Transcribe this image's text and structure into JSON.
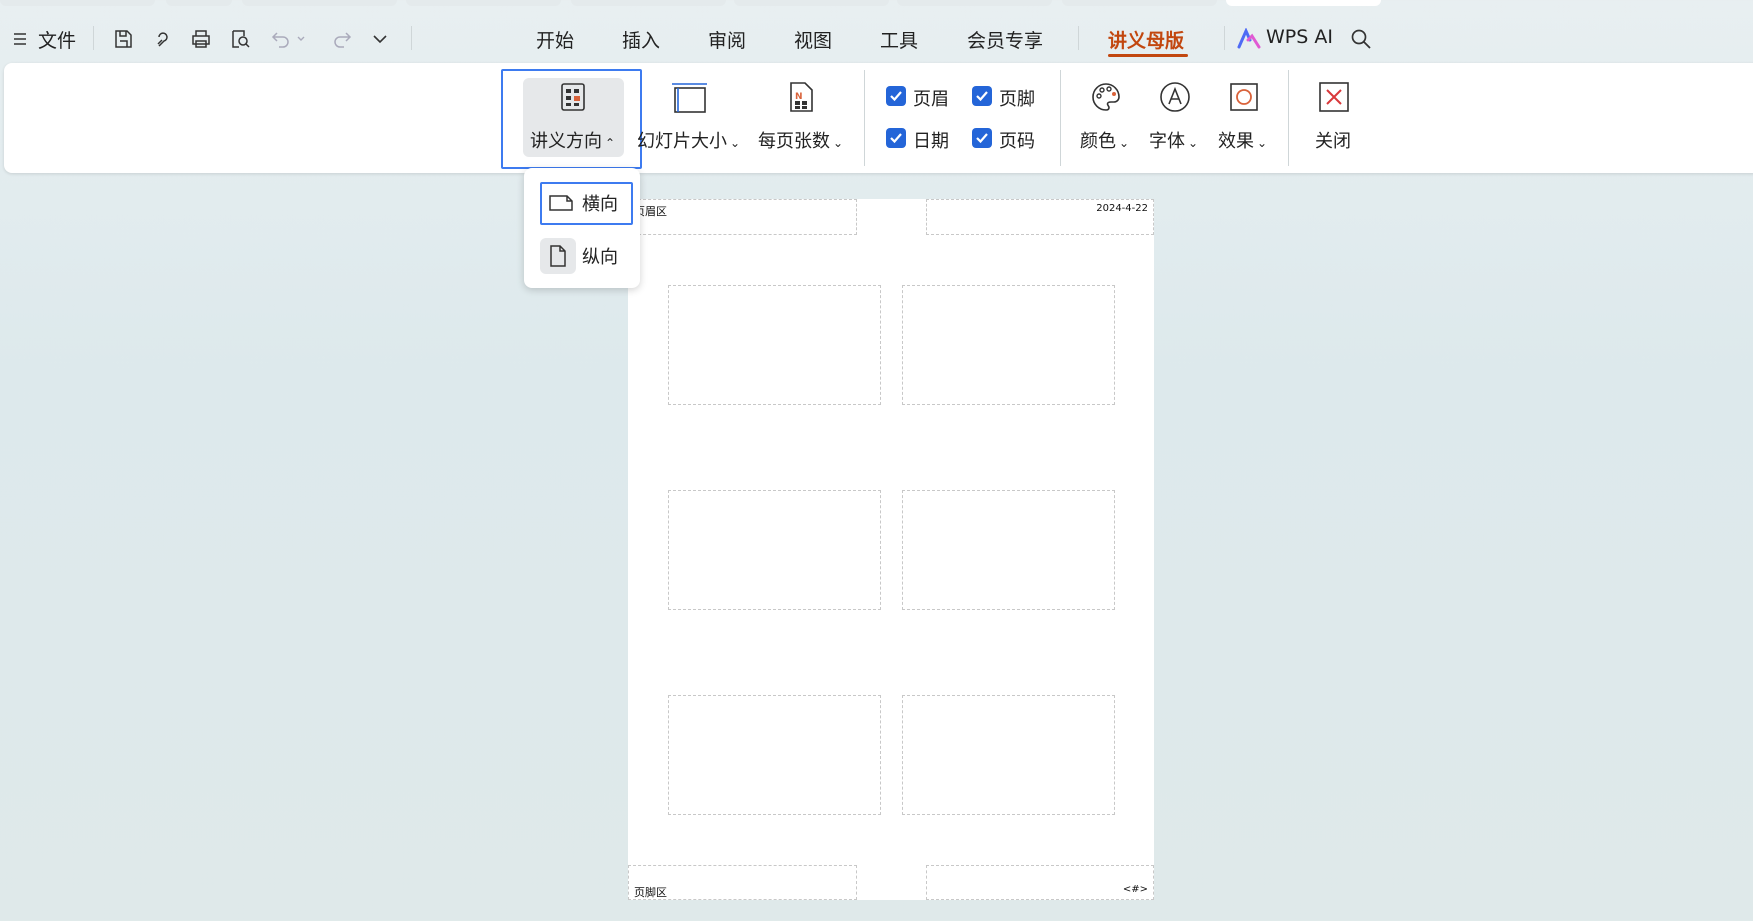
{
  "menubar": {
    "menu_label": "文件",
    "tabs": [
      {
        "label": "开始"
      },
      {
        "label": "插入"
      },
      {
        "label": "审阅"
      },
      {
        "label": "视图"
      },
      {
        "label": "工具"
      },
      {
        "label": "会员专享"
      },
      {
        "label": "讲义母版",
        "active": true
      }
    ],
    "ai_label": "WPS AI"
  },
  "ribbon": {
    "handout_orientation": "讲义方向",
    "slide_size": "幻灯片大小",
    "slides_per_page": "每页张数",
    "checkboxes": [
      {
        "label": "页眉",
        "checked": true
      },
      {
        "label": "页脚",
        "checked": true
      },
      {
        "label": "日期",
        "checked": true
      },
      {
        "label": "页码",
        "checked": true
      }
    ],
    "color": "颜色",
    "font": "字体",
    "effect": "效果",
    "close": "关闭"
  },
  "dropdown": {
    "items": [
      {
        "label": "横向",
        "selected": true
      },
      {
        "label": "纵向",
        "selected": false
      }
    ]
  },
  "page": {
    "header_area": "页眉区",
    "date": "2024-4-22",
    "footer_area": "页脚区",
    "page_number": "<#>"
  },
  "colors": {
    "accent_orange": "#c2470f",
    "highlight_blue": "#3d7bf0",
    "checkbox_blue": "#2465d8",
    "close_red": "#d9383a"
  }
}
